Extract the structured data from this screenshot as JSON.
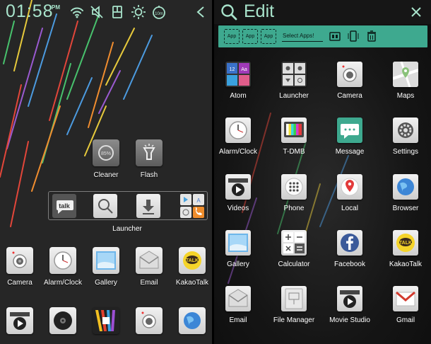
{
  "left": {
    "status_bar": {
      "time": "01:58",
      "ampm": "PM",
      "icons": [
        "wifi-icon",
        "mute-icon",
        "sim-icon",
        "brightness-icon",
        "timer-icon",
        "back-chevron-icon"
      ]
    },
    "apps_top": [
      {
        "label": "Cleaner",
        "icon": "cleaner-icon"
      },
      {
        "label": "Flash",
        "icon": "flashlight-icon"
      }
    ],
    "folder": {
      "label": "Launcher",
      "items": [
        "kakaotalk-talk-icon",
        "search-icon",
        "download-icon",
        "launcher-grid-icon"
      ]
    },
    "dock_row1": [
      {
        "label": "Camera",
        "icon": "camera-icon"
      },
      {
        "label": "Alarm/Clock",
        "icon": "clock-icon"
      },
      {
        "label": "Gallery",
        "icon": "gallery-icon"
      },
      {
        "label": "Email",
        "icon": "email-icon"
      },
      {
        "label": "KakaoTalk",
        "icon": "kakaotalk-icon"
      }
    ],
    "dock_row2": [
      {
        "label": "",
        "icon": "video-icon"
      },
      {
        "label": "",
        "icon": "music-disc-icon"
      },
      {
        "label": "",
        "icon": "colorful-app-icon"
      },
      {
        "label": "",
        "icon": "camera-icon"
      },
      {
        "label": "",
        "icon": "globe-icon"
      }
    ]
  },
  "right": {
    "header": {
      "title": "Edit"
    },
    "toolbar": {
      "slots": [
        "App",
        "App",
        "App"
      ],
      "select_label": "Select Apps!"
    },
    "grid": [
      {
        "label": "Atom",
        "icon": "atom-icon"
      },
      {
        "label": "Launcher",
        "icon": "launcher-icon"
      },
      {
        "label": "Camera",
        "icon": "camera-icon"
      },
      {
        "label": "Maps",
        "icon": "maps-icon"
      },
      {
        "label": "Alarm/Clock",
        "icon": "clock-icon"
      },
      {
        "label": "T-DMB",
        "icon": "tv-icon"
      },
      {
        "label": "Message",
        "icon": "message-icon"
      },
      {
        "label": "Settings",
        "icon": "settings-icon"
      },
      {
        "label": "Videos",
        "icon": "video-icon"
      },
      {
        "label": "Phone",
        "icon": "phone-keypad-icon"
      },
      {
        "label": "Local",
        "icon": "location-pin-icon"
      },
      {
        "label": "Browser",
        "icon": "globe-icon"
      },
      {
        "label": "Gallery",
        "icon": "gallery-icon"
      },
      {
        "label": "Calculator",
        "icon": "calculator-icon"
      },
      {
        "label": "Facebook",
        "icon": "facebook-icon"
      },
      {
        "label": "KakaoTalk",
        "icon": "kakaotalk-icon"
      },
      {
        "label": "Email",
        "icon": "email-icon"
      },
      {
        "label": "File Manager",
        "icon": "file-manager-icon"
      },
      {
        "label": "Movie Studio",
        "icon": "movie-studio-icon"
      },
      {
        "label": "Gmail",
        "icon": "gmail-icon"
      }
    ]
  },
  "colors": {
    "accent": "#a8e3cb",
    "toolbar": "#3ea98f"
  }
}
